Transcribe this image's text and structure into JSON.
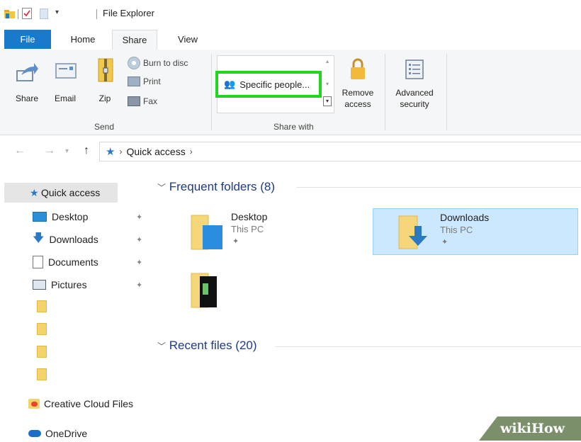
{
  "window": {
    "title": "File Explorer"
  },
  "tabs": {
    "file": "File",
    "home": "Home",
    "share": "Share",
    "view": "View"
  },
  "ribbon": {
    "share": "Share",
    "email": "Email",
    "zip": "Zip",
    "burn": "Burn to disc",
    "print": "Print",
    "fax": "Fax",
    "send_group": "Send",
    "specific_people": "Specific people...",
    "remove_access_1": "Remove",
    "remove_access_2": "access",
    "advanced_security_1": "Advanced",
    "advanced_security_2": "security",
    "share_with_group": "Share with"
  },
  "address": {
    "path": "Quick access"
  },
  "nav": {
    "quick_access": "Quick access",
    "items": [
      "Desktop",
      "Downloads",
      "Documents",
      "Pictures"
    ],
    "creative_cloud": "Creative Cloud Files",
    "onedrive": "OneDrive"
  },
  "content": {
    "frequent_title": "Frequent folders (8)",
    "recent_title": "Recent files (20)",
    "tiles": [
      {
        "name": "Desktop",
        "sub": "This PC"
      },
      {
        "name": "Downloads",
        "sub": "This PC"
      }
    ]
  },
  "watermark": "wikiHow",
  "colors": {
    "accent": "#1979ca",
    "highlight_box": "#22d51e",
    "selected_tile": "#cce8ff"
  }
}
